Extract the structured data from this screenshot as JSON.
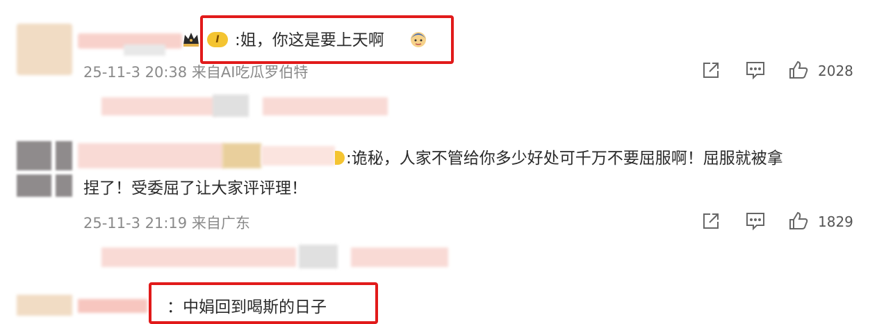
{
  "comments": [
    {
      "text": ":姐，你这是要上天啊",
      "meta": "25-11-3 20:38 来自AI吃瓜罗伯特",
      "likes": "2028",
      "emoji": "girl-emoji",
      "badge": "I"
    },
    {
      "text_line1": ":诡秘，人家不管给你多少好处可千万不要屈服啊！屈服就被拿",
      "text_line2": "捏了！受委屈了让大家评评理！",
      "meta": "25-11-3 21:19 来自广东",
      "likes": "1829"
    },
    {
      "text": "：中娟回到喝斯的日子"
    }
  ],
  "icons": [
    "share-icon",
    "comment-icon",
    "like-icon"
  ],
  "colors": {
    "highlight": "#e11a1a",
    "meta": "#8a8a8a",
    "text": "#2a2a2a"
  }
}
